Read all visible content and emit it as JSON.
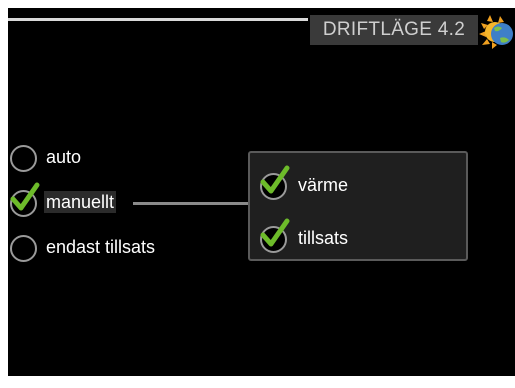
{
  "header": {
    "title": "DRIFTLÄGE 4.2",
    "icon": "sun-icon"
  },
  "options": [
    {
      "label": "auto",
      "selected": false
    },
    {
      "label": "manuellt",
      "selected": true
    },
    {
      "label": "endast tillsats",
      "selected": false
    }
  ],
  "submenu": {
    "items": [
      {
        "label": "värme",
        "checked": true
      },
      {
        "label": "tillsats",
        "checked": true
      }
    ]
  },
  "colors": {
    "background": "#000000",
    "check_green": "#6dbb2a",
    "title_bg": "#3a3a3a",
    "text": "#ffffff"
  }
}
